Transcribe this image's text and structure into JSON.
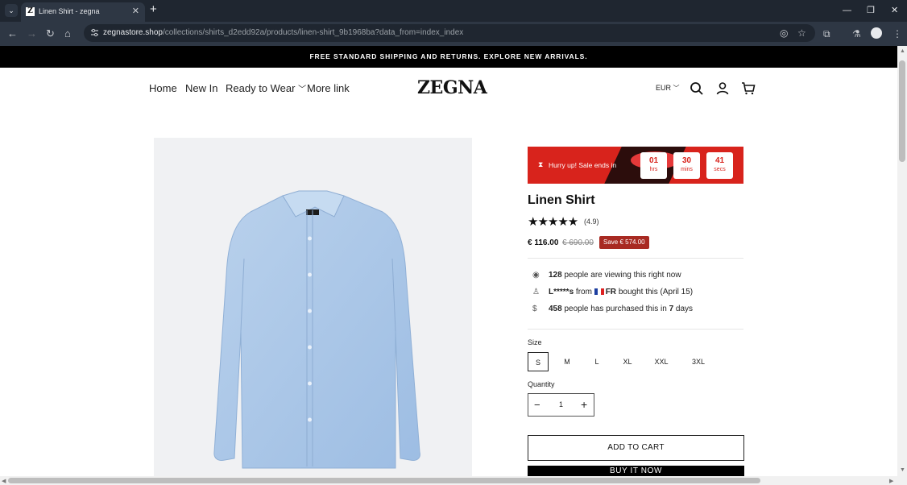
{
  "browser": {
    "tab_title": "Linen Shirt - zegna",
    "tab_favicon_letter": "Z",
    "url_domain": "zegnastore.shop",
    "url_path": "/collections/shirts_d2edd92a/products/linen-shirt_9b1968ba?data_from=index_index"
  },
  "announcement": "FREE STANDARD SHIPPING AND RETURNS. EXPLORE NEW ARRIVALS.",
  "header": {
    "nav": [
      "Home",
      "New In",
      "Ready to Wear",
      "More link"
    ],
    "logo": "ZEGNA",
    "currency": "EUR"
  },
  "sale_banner": {
    "text": "Hurry up!  Sale ends in",
    "timers": [
      {
        "value": "01",
        "unit": "hrs"
      },
      {
        "value": "30",
        "unit": "mins"
      },
      {
        "value": "41",
        "unit": "secs"
      }
    ]
  },
  "product": {
    "title": "Linen Shirt",
    "stars": "★★★★★",
    "rating_value": 4.9,
    "rating_text": "(4.9)",
    "price": "€ 116.00",
    "compare_price": "€ 690.00",
    "save_label": "Save € 574.00"
  },
  "social_proof": {
    "viewers_count": "128",
    "viewers_text": "people are viewing this right now",
    "recent_buyer": "L*****s",
    "recent_from": "from",
    "recent_country": "FR",
    "recent_text": "bought this (April 15)",
    "purchased_count": "458",
    "purchased_text": "people has purchased this in",
    "purchased_days": "7",
    "purchased_days_label": "days"
  },
  "size": {
    "label": "Size",
    "options": [
      "S",
      "M",
      "L",
      "XL",
      "XXL",
      "3XL"
    ],
    "selected": "S"
  },
  "quantity": {
    "label": "Quantity",
    "value": "1"
  },
  "buttons": {
    "add_to_cart": "ADD TO CART",
    "buy_now": "BUY IT NOW"
  }
}
